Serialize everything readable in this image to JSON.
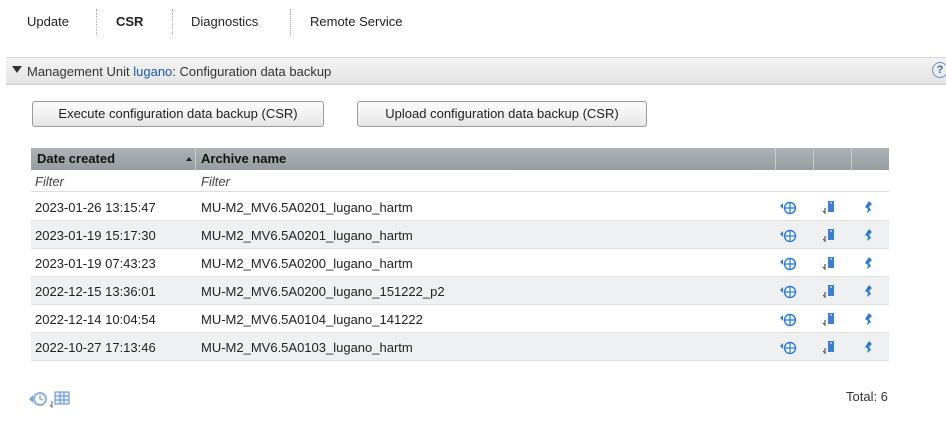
{
  "tabs": [
    {
      "label": "Update"
    },
    {
      "label": "CSR"
    },
    {
      "label": "Diagnostics"
    },
    {
      "label": "Remote Service"
    }
  ],
  "section": {
    "prefix": "Management Unit ",
    "unit": "lugano",
    "suffix": ": Configuration data backup",
    "help": "?"
  },
  "buttons": {
    "execute": "Execute configuration data backup (CSR)",
    "upload": "Upload configuration data backup (CSR)"
  },
  "table": {
    "headers": {
      "date": "Date created",
      "archive": "Archive name"
    },
    "filters": {
      "date": "Filter",
      "archive": "Filter"
    },
    "rows": [
      {
        "date": "2023-01-26 13:15:47",
        "archive": "MU-M2_MV6.5A0201_lugano_hartm"
      },
      {
        "date": "2023-01-19 15:17:30",
        "archive": "MU-M2_MV6.5A0201_lugano_hartm"
      },
      {
        "date": "2023-01-19 07:43:23",
        "archive": "MU-M2_MV6.5A0200_lugano_hartm"
      },
      {
        "date": "2022-12-15 13:36:01",
        "archive": "MU-M2_MV6.5A0200_lugano_151222_p2"
      },
      {
        "date": "2022-12-14 10:04:54",
        "archive": "MU-M2_MV6.5A0104_lugano_141222"
      },
      {
        "date": "2022-10-27 17:13:46",
        "archive": "MU-M2_MV6.5A0103_lugano_hartm"
      }
    ]
  },
  "footer": {
    "total": "Total: 6"
  },
  "colors": {
    "accent": "#1a5aa8",
    "header_bg": "#a3a8ae",
    "row_alt": "#eef0f2"
  }
}
